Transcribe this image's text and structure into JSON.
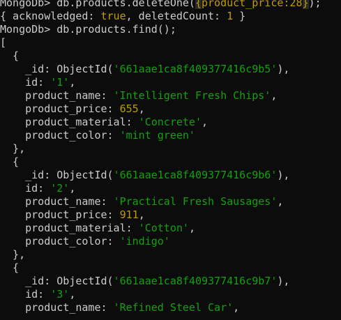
{
  "terminal": {
    "lines": [
      [
        {
          "t": "MongoDb> db.products.deleteOne(",
          "c": "default"
        },
        {
          "t": "{",
          "c": "hilite"
        },
        {
          "t": "product_price:28",
          "c": "number"
        },
        {
          "t": "}",
          "c": "hilite"
        },
        {
          "t": ");",
          "c": "default"
        }
      ],
      [
        {
          "t": "{ acknowledged: ",
          "c": "default"
        },
        {
          "t": "true",
          "c": "bool"
        },
        {
          "t": ", deletedCount: ",
          "c": "default"
        },
        {
          "t": "1",
          "c": "number"
        },
        {
          "t": " }",
          "c": "default"
        }
      ],
      [
        {
          "t": "MongoDb> db.products.find();",
          "c": "default"
        }
      ],
      [
        {
          "t": "[",
          "c": "default"
        }
      ],
      [
        {
          "t": "  {",
          "c": "default"
        }
      ],
      [
        {
          "t": "    _id: ObjectId(",
          "c": "default"
        },
        {
          "t": "'661aae1ca8f409377416c9b5'",
          "c": "string"
        },
        {
          "t": "),",
          "c": "default"
        }
      ],
      [
        {
          "t": "    id: ",
          "c": "default"
        },
        {
          "t": "'1'",
          "c": "string"
        },
        {
          "t": ",",
          "c": "default"
        }
      ],
      [
        {
          "t": "    product_name: ",
          "c": "default"
        },
        {
          "t": "'Intelligent Fresh Chips'",
          "c": "string"
        },
        {
          "t": ",",
          "c": "default"
        }
      ],
      [
        {
          "t": "    product_price: ",
          "c": "default"
        },
        {
          "t": "655",
          "c": "number"
        },
        {
          "t": ",",
          "c": "default"
        }
      ],
      [
        {
          "t": "    product_material: ",
          "c": "default"
        },
        {
          "t": "'Concrete'",
          "c": "string"
        },
        {
          "t": ",",
          "c": "default"
        }
      ],
      [
        {
          "t": "    product_color: ",
          "c": "default"
        },
        {
          "t": "'mint green'",
          "c": "string"
        }
      ],
      [
        {
          "t": "  },",
          "c": "default"
        }
      ],
      [
        {
          "t": "  {",
          "c": "default"
        }
      ],
      [
        {
          "t": "    _id: ObjectId(",
          "c": "default"
        },
        {
          "t": "'661aae1ca8f409377416c9b6'",
          "c": "string"
        },
        {
          "t": "),",
          "c": "default"
        }
      ],
      [
        {
          "t": "    id: ",
          "c": "default"
        },
        {
          "t": "'2'",
          "c": "string"
        },
        {
          "t": ",",
          "c": "default"
        }
      ],
      [
        {
          "t": "    product_name: ",
          "c": "default"
        },
        {
          "t": "'Practical Fresh Sausages'",
          "c": "string"
        },
        {
          "t": ",",
          "c": "default"
        }
      ],
      [
        {
          "t": "    product_price: ",
          "c": "default"
        },
        {
          "t": "911",
          "c": "number"
        },
        {
          "t": ",",
          "c": "default"
        }
      ],
      [
        {
          "t": "    product_material: ",
          "c": "default"
        },
        {
          "t": "'Cotton'",
          "c": "string"
        },
        {
          "t": ",",
          "c": "default"
        }
      ],
      [
        {
          "t": "    product_color: ",
          "c": "default"
        },
        {
          "t": "'indigo'",
          "c": "string"
        }
      ],
      [
        {
          "t": "  },",
          "c": "default"
        }
      ],
      [
        {
          "t": "  {",
          "c": "default"
        }
      ],
      [
        {
          "t": "    _id: ObjectId(",
          "c": "default"
        },
        {
          "t": "'661aae1ca8f409377416c9b7'",
          "c": "string"
        },
        {
          "t": "),",
          "c": "default"
        }
      ],
      [
        {
          "t": "    id: ",
          "c": "default"
        },
        {
          "t": "'3'",
          "c": "string"
        },
        {
          "t": ",",
          "c": "default"
        }
      ],
      [
        {
          "t": "    product_name: ",
          "c": "default"
        },
        {
          "t": "'Refined Steel Car'",
          "c": "string"
        },
        {
          "t": ",",
          "c": "default"
        }
      ],
      [
        {
          "t": "    ",
          "c": "default"
        }
      ]
    ]
  },
  "colors": {
    "background": "#0c0c0c",
    "text": "#cccccc",
    "string": "#13a10e",
    "number": "#c19c00"
  }
}
